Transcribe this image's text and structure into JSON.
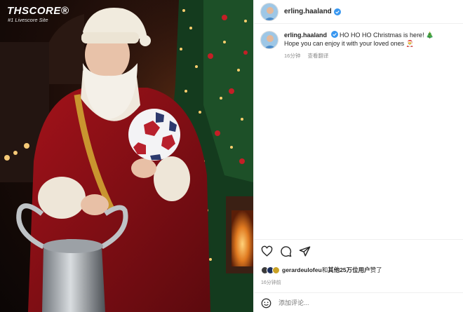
{
  "photo": {
    "watermark_main": "THSCORE®",
    "watermark_sub": "#1 Livescore Site"
  },
  "post": {
    "author": "erling.haaland",
    "verified_icon": "verified-badge-icon",
    "comment": {
      "username": "erling.haaland",
      "text_line1": "HO HO HO Christmas is here! 🎄",
      "text_line2": "Hope you can enjoy it with your loved ones 🎅",
      "time": "16分钟",
      "see_translation": "查看翻译"
    },
    "actions": {
      "like_icon": "heart-icon",
      "comment_icon": "comment-icon",
      "share_icon": "send-icon"
    },
    "likes": {
      "liker": "gerardeulofeu",
      "connector": "和",
      "others": "其他25万位用户",
      "suffix": "赞了"
    },
    "post_time": "16分钟前",
    "add_comment": {
      "emoji_icon": "emoji-icon",
      "placeholder": "添加评论..."
    }
  },
  "colors": {
    "verified_blue": "#3897f0",
    "text": "#262626",
    "secondary": "#8e8e8e",
    "divider": "#efefef"
  }
}
